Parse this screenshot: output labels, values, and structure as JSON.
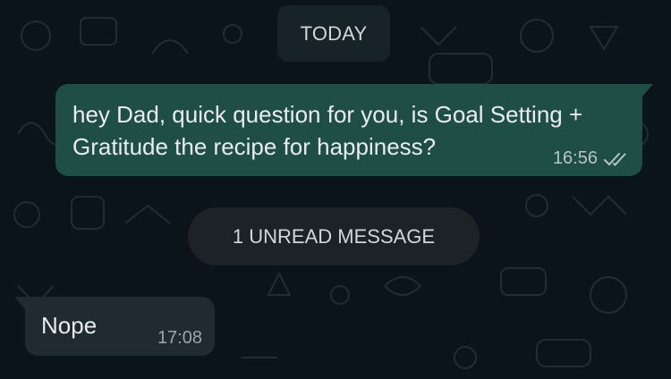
{
  "chat": {
    "date_separator": "TODAY",
    "unread_notice": "1 UNREAD MESSAGE",
    "messages": [
      {
        "direction": "outgoing",
        "text": "hey Dad, quick question for you, is Goal Setting + Gratitude the recipe for happiness?",
        "time": "16:56",
        "status_icon": "double-check-icon"
      },
      {
        "direction": "incoming",
        "text": "Nope",
        "time": "17:08"
      }
    ]
  },
  "colors": {
    "background": "#0b141a",
    "outgoing_bubble": "#1f4e44",
    "incoming_bubble": "#1f2a31",
    "chip": "#182229",
    "text": "#e9edef",
    "meta_text": "#9aa6ad"
  }
}
